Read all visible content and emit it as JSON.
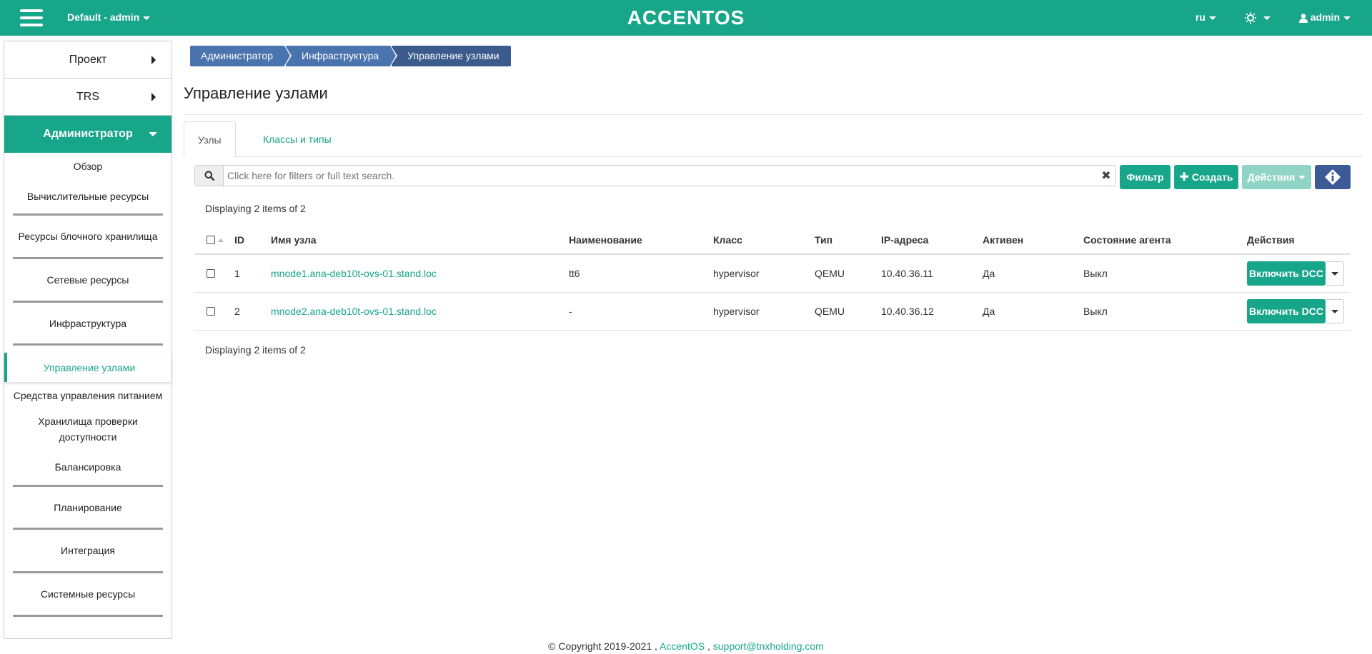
{
  "topbar": {
    "project": "Default - admin",
    "logo": "ACCENTOS",
    "language": "ru",
    "user": "admin"
  },
  "sidebar": {
    "project": "Проект",
    "trs": "TRS",
    "admin": "Администратор",
    "items": [
      "Обзор",
      "Вычислительные ресурсы",
      "Ресурсы блочного хранилища",
      "Сетевые ресурсы",
      "Инфраструктура",
      "Управление узлами",
      "Средства управления питанием",
      "Хранилища проверки доступности",
      "Балансировка",
      "Планирование",
      "Интеграция",
      "Системные ресурсы"
    ]
  },
  "breadcrumb": [
    "Администратор",
    "Инфраструктура",
    "Управление узлами"
  ],
  "page_title": "Управление узлами",
  "tabs": [
    "Узлы",
    "Классы и типы"
  ],
  "search": {
    "placeholder": "Click here for filters or full text search."
  },
  "buttons": {
    "filter": "Фильтр",
    "create": "Создать",
    "actions": "Действия"
  },
  "displaying": "Displaying 2 items of 2",
  "table": {
    "headers": [
      "ID",
      "Имя узла",
      "Наименование",
      "Класс",
      "Тип",
      "IP-адреса",
      "Активен",
      "Состояние агента",
      "Действия"
    ],
    "rows": [
      {
        "id": "1",
        "name": "mnode1.ana-deb10t-ovs-01.stand.loc",
        "title": "tt6",
        "class": "hypervisor",
        "type": "QEMU",
        "ip": "10.40.36.11",
        "active": "Да",
        "agent": "Выкл",
        "action": "Включить DCC"
      },
      {
        "id": "2",
        "name": "mnode2.ana-deb10t-ovs-01.stand.loc",
        "title": "-",
        "class": "hypervisor",
        "type": "QEMU",
        "ip": "10.40.36.12",
        "active": "Да",
        "agent": "Выкл",
        "action": "Включить DCC"
      }
    ]
  },
  "footer": {
    "copyright": "© Copyright 2019-2021 ,",
    "brand": "AccentOS",
    "sep": ",",
    "email": "support@tnxholding.com"
  }
}
